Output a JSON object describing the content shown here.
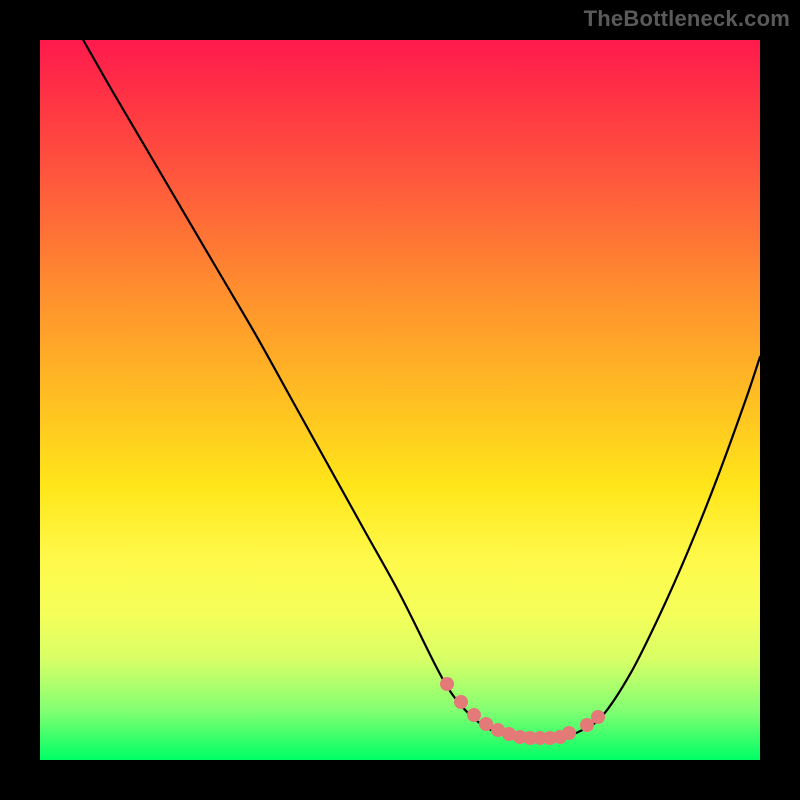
{
  "watermark": "TheBottleneck.com",
  "colors": {
    "frame": "#000000",
    "curve": "#000000",
    "marker": "#e37a78"
  },
  "chart_data": {
    "type": "line",
    "title": "",
    "xlabel": "",
    "ylabel": "",
    "xlim": [
      0,
      100
    ],
    "ylim": [
      0,
      100
    ],
    "grid": false,
    "series": [
      {
        "name": "bottleneck-curve",
        "x": [
          6,
          10,
          15,
          20,
          25,
          30,
          35,
          40,
          45,
          50,
          55,
          57,
          59,
          61,
          63,
          65,
          67,
          69,
          71,
          73,
          75,
          78,
          82,
          86,
          90,
          94,
          98,
          100
        ],
        "y": [
          100,
          93,
          84.5,
          76,
          67.5,
          59,
          50,
          41,
          32,
          23,
          13,
          9.5,
          7,
          5.2,
          4,
          3.3,
          3,
          3,
          3,
          3.3,
          4,
          6,
          12,
          20,
          29,
          39,
          50,
          56
        ]
      }
    ],
    "markers": {
      "name": "highlight-dots",
      "x": [
        56.5,
        58.5,
        60.3,
        62.0,
        63.6,
        65.2,
        66.7,
        68.1,
        69.5,
        70.9,
        72.2,
        73.5,
        76.0,
        77.5
      ],
      "y": [
        10.5,
        8.0,
        6.2,
        5.0,
        4.2,
        3.6,
        3.2,
        3.0,
        3.0,
        3.0,
        3.2,
        3.7,
        4.8,
        6.0
      ]
    }
  }
}
